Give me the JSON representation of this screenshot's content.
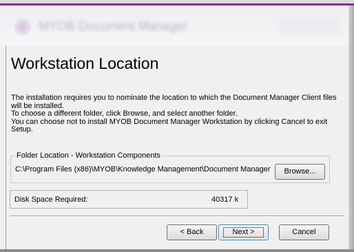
{
  "header": {
    "blurred_title": "MYOB Document Manager"
  },
  "page": {
    "title": "Workstation Location",
    "description": [
      "The installation requires you to nominate the location to which the Document Manager Client files",
      "will be installed.",
      "To choose a different folder, click Browse, and select another folder.",
      "You can choose not to install MYOB Document Manager Workstation by clicking Cancel to exit",
      "Setup."
    ]
  },
  "folder_group": {
    "legend": "Folder Location - Workstation Components",
    "path": "C:\\Program Files (x86)\\MYOB\\Knowledge Management\\Document Manager",
    "browse_label": "Browse..."
  },
  "disk_space": {
    "label": "Disk Space Required:",
    "value": "40317 k"
  },
  "buttons": {
    "back_label": "< Back",
    "next_label": "Next >",
    "cancel_label": "Cancel"
  },
  "colors": {
    "accent": "#8a2d85",
    "window_bg": "#f0f0f0"
  }
}
